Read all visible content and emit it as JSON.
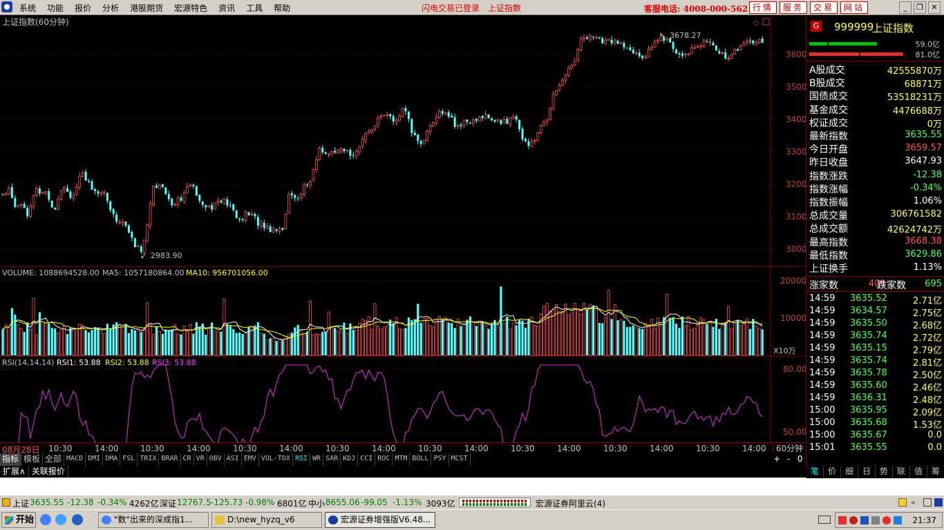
{
  "menu": {
    "items": [
      "系统",
      "功能",
      "报价",
      "分析",
      "港股期货",
      "宏源特色",
      "资讯",
      "工具",
      "帮助"
    ],
    "status_flash": "闪电交易已登录",
    "status_index": "上证指数",
    "hotline": "客服电话: 4008-000-562",
    "tabs": [
      "行情",
      "服务",
      "交易",
      "网站"
    ]
  },
  "chart": {
    "title": "上证指数(60分钟)",
    "high_label": "3678.27",
    "low_label": "2983.90",
    "price_ticks": [
      "3600",
      "3500",
      "3400",
      "3300",
      "3200",
      "3100",
      "3000"
    ],
    "volume_header": {
      "vol_label": "VOLUME: 1088694528.00",
      "ma5_label": "MA5: 1057180864.00",
      "ma10_label": "MA10: 956701056.00"
    },
    "volume_ticks": [
      "20000",
      "10000"
    ],
    "volume_unit": "X10万",
    "rsi_header": {
      "name": "RSI(14,14,14)",
      "rsi1": "RSI1: 53.88",
      "rsi2": "RSI2: 53.88",
      "rsi3": "RSI3: 53.88"
    },
    "rsi_ticks": [
      "80.00",
      "50.00"
    ],
    "x_labels": [
      "08月28日",
      "10:30",
      "14:00",
      "10:30",
      "14:00",
      "10:30",
      "14:00",
      "10:30",
      "14:00",
      "10:30",
      "14:00",
      "10:30",
      "14:00",
      "10:30",
      "14:00",
      "10:30",
      "14:00"
    ],
    "period": "60分钟",
    "colors": {
      "up": "#ff5454",
      "down": "#54ffff",
      "ma5": "#ffffff",
      "ma10": "#ffff00",
      "rsi": "#c030c0",
      "grid": "#800000"
    }
  },
  "indicator_tabs": [
    "指标",
    "模板",
    "全部",
    "MACD",
    "DMI",
    "DMA",
    "FSL",
    "TRIX",
    "BRAR",
    "CR",
    "VR",
    "OBV",
    "ASI",
    "EMV",
    "VOL-TDX",
    "RSI",
    "WR",
    "SAR",
    "KDJ",
    "CCI",
    "ROC",
    "MTM",
    "BOLL",
    "PSY",
    "MCST"
  ],
  "zoom_controls": [
    "+",
    "-",
    "0"
  ],
  "ext_tabs": [
    "扩展∧",
    "关联报价"
  ],
  "quote": {
    "badge": "G",
    "code": "999999",
    "name": "上证指数",
    "bar1_val": "59.0亿",
    "bar2_val": "81.0亿",
    "rows": [
      {
        "k": "A股成交",
        "v": "42555870万",
        "c": "yellow"
      },
      {
        "k": "B股成交",
        "v": "68871万",
        "c": "yellow"
      },
      {
        "k": "国债成交",
        "v": "53518231万",
        "c": "yellow"
      },
      {
        "k": "基金成交",
        "v": "4476688万",
        "c": "yellow"
      },
      {
        "k": "权证成交",
        "v": "0万",
        "c": "yellow"
      },
      {
        "k": "最新指数",
        "v": "3635.55",
        "c": "green"
      },
      {
        "k": "今日开盘",
        "v": "3659.57",
        "c": "red"
      },
      {
        "k": "昨日收盘",
        "v": "3647.93",
        "c": "white"
      },
      {
        "k": "指数涨跌",
        "v": "-12.38",
        "c": "green"
      },
      {
        "k": "指数涨幅",
        "v": "-0.34%",
        "c": "green"
      },
      {
        "k": "指数振幅",
        "v": "1.06%",
        "c": "white"
      },
      {
        "k": "总成交量",
        "v": "306761582",
        "c": "yellow"
      },
      {
        "k": "总成交额",
        "v": "42624742万",
        "c": "yellow"
      },
      {
        "k": "最高指数",
        "v": "3668.38",
        "c": "red"
      },
      {
        "k": "最低指数",
        "v": "3629.86",
        "c": "green"
      },
      {
        "k": "上证换手",
        "v": "1.13%",
        "c": "white"
      }
    ],
    "up_label": "涨家数",
    "up_count": "409",
    "down_label": "跌家数",
    "down_count": "695",
    "ticks": [
      {
        "t": "14:59",
        "p": "3635.52",
        "a": "2.71亿"
      },
      {
        "t": "14:59",
        "p": "3634.57",
        "a": "2.75亿"
      },
      {
        "t": "14:59",
        "p": "3635.50",
        "a": "2.68亿"
      },
      {
        "t": "14:59",
        "p": "3635.74",
        "a": "2.72亿"
      },
      {
        "t": "14:59",
        "p": "3635.15",
        "a": "2.79亿"
      },
      {
        "t": "14:59",
        "p": "3635.74",
        "a": "2.81亿"
      },
      {
        "t": "14:59",
        "p": "3635.78",
        "a": "2.50亿"
      },
      {
        "t": "14:59",
        "p": "3635.60",
        "a": "2.46亿"
      },
      {
        "t": "14:59",
        "p": "3636.31",
        "a": "2.48亿"
      },
      {
        "t": "15:00",
        "p": "3635.95",
        "a": "2.09亿"
      },
      {
        "t": "15:00",
        "p": "3635.68",
        "a": "1.53亿"
      },
      {
        "t": "15:00",
        "p": "3635.67",
        "a": "0.0"
      },
      {
        "t": "15:01",
        "p": "3635.55",
        "a": "0.0"
      }
    ],
    "tabs": [
      "笔",
      "价",
      "细",
      "日",
      "势",
      "联",
      "值",
      "筹"
    ]
  },
  "ticker": {
    "sh_name": "上证",
    "sh_price": "3635.55",
    "sh_chg": "-12.38",
    "sh_pct": "-0.34%",
    "sh_amt": "4262亿",
    "sz_name": "深证",
    "sz_price": "12767.5",
    "sz_chg": "-125.73",
    "sz_pct": "-0.98%",
    "sz_amt": "6801亿",
    "zx_name": "中小",
    "zx_price": "8655.06",
    "zx_chg": "-99.05",
    "zx_pct": "-1.13%",
    "zx_amt": "3093亿",
    "broker": "宏源证券阿里云(4)"
  },
  "taskbar": {
    "start": "开始",
    "tasks": [
      "\"数\"出来的深成指1...",
      "D:\\new_hyzq_v6",
      "宏源证券增强版V6.48..."
    ],
    "clock": "21:37"
  }
}
